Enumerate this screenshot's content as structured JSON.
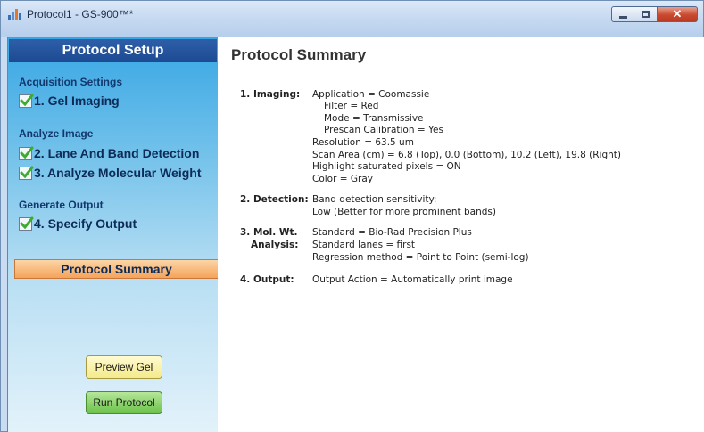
{
  "window": {
    "title": "Protocol1 - GS-900™*",
    "icon": "app-chart-icon"
  },
  "sidebar": {
    "header": "Protocol Setup",
    "sections": {
      "acquisition": "Acquisition Settings",
      "analyze": "Analyze Image",
      "generate": "Generate Output"
    },
    "steps": [
      {
        "label": "1. Gel Imaging",
        "checked": true
      },
      {
        "label": "2. Lane And Band Detection",
        "checked": true
      },
      {
        "label": "3. Analyze Molecular Weight",
        "checked": true
      },
      {
        "label": "4. Specify Output",
        "checked": true
      }
    ],
    "summary_button": "Protocol Summary",
    "preview_button": "Preview Gel",
    "run_button": "Run Protocol"
  },
  "main": {
    "title": "Protocol Summary",
    "imaging": {
      "label": "1. Imaging:",
      "lines": [
        "Application = Coomassie",
        "Filter = Red",
        "Mode = Transmissive",
        "Prescan Calibration = Yes",
        "Resolution = 63.5 um",
        "Scan Area (cm) = 6.8 (Top), 0.0 (Bottom), 10.2 (Left), 19.8 (Right)",
        "Highlight saturated pixels = ON",
        "Color = Gray"
      ]
    },
    "detection": {
      "label": "2. Detection:",
      "lines": [
        "Band detection sensitivity:",
        "Low (Better for more prominent bands)"
      ]
    },
    "molwt": {
      "label_line1": "3. Mol. Wt.",
      "label_line2": "Analysis:",
      "lines": [
        "Standard = Bio-Rad Precision Plus",
        "Standard lanes = first",
        "Regression method = Point to Point (semi-log)"
      ]
    },
    "output": {
      "label": "4. Output:",
      "lines": [
        "Output Action = Automatically print image"
      ]
    }
  }
}
